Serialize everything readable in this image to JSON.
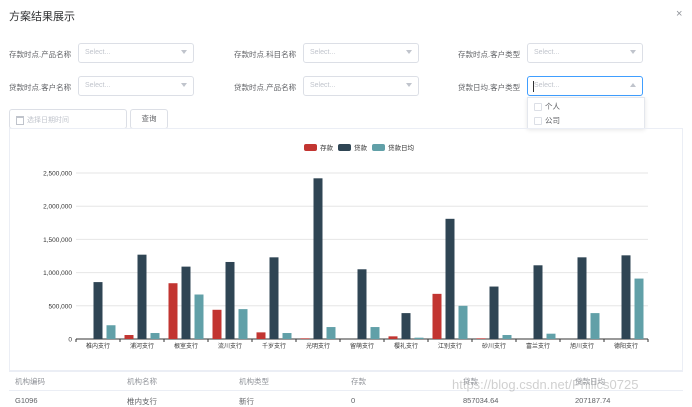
{
  "dialog": {
    "title": "方案结果展示",
    "close": "×"
  },
  "filters": {
    "row1": [
      {
        "label": "存款时点.产品名称",
        "placeholder": "Select..."
      },
      {
        "label": "存款时点.科目名称",
        "placeholder": "Select..."
      },
      {
        "label": "存款时点.客户类型",
        "placeholder": "Select..."
      }
    ],
    "row2": [
      {
        "label": "贷款时点.客户名称",
        "placeholder": "Select..."
      },
      {
        "label": "贷款时点.产品名称",
        "placeholder": "Select..."
      },
      {
        "label": "贷款日均.客户类型",
        "placeholder": "Select..."
      }
    ],
    "dropdown_options": [
      "个人",
      "公司"
    ],
    "date_placeholder": "选择日期时间",
    "query_button": "查询"
  },
  "colors": {
    "deposit": "#c23531",
    "loan": "#2f4554",
    "loan_avg": "#61a0a8"
  },
  "chart_data": {
    "type": "bar",
    "legend_position": "top-center",
    "categories": [
      "椎内支行",
      "浦河支行",
      "根室支行",
      "流川支行",
      "千岁支行",
      "光明支行",
      "留萌支行",
      "樱礼支行",
      "江别支行",
      "砂川支行",
      "富兰支行",
      "旭川支行",
      "德阳支行"
    ],
    "series": [
      {
        "name": "存款",
        "color": "#c23531",
        "values": [
          0,
          60000,
          840000,
          440000,
          100000,
          10000,
          0,
          40000,
          680000,
          10000,
          0,
          0,
          0
        ]
      },
      {
        "name": "贷款",
        "color": "#2f4554",
        "values": [
          857035,
          1270000,
          1090000,
          1160000,
          1230000,
          2420000,
          1050000,
          390000,
          1810000,
          790000,
          1110000,
          1230000,
          1260000
        ]
      },
      {
        "name": "贷款日均",
        "color": "#61a0a8",
        "values": [
          207188,
          90000,
          670000,
          450000,
          90000,
          180000,
          180000,
          20000,
          500000,
          60000,
          80000,
          390000,
          910000
        ]
      }
    ],
    "yticks": [
      "0",
      "500,000",
      "1,000,000",
      "1,500,000",
      "2,000,000",
      "2,500,000"
    ],
    "ylim": [
      0,
      2500000
    ],
    "grid": true
  },
  "table": {
    "headers": [
      "机构编码",
      "机构名称",
      "机构类型",
      "存款",
      "贷款",
      "贷款日均"
    ],
    "rows": [
      [
        "G1096",
        "椎内支行",
        "新行",
        "0",
        "857034.64",
        "207187.74"
      ]
    ]
  },
  "watermark": "https://blog.csdn.net/Philics0725"
}
